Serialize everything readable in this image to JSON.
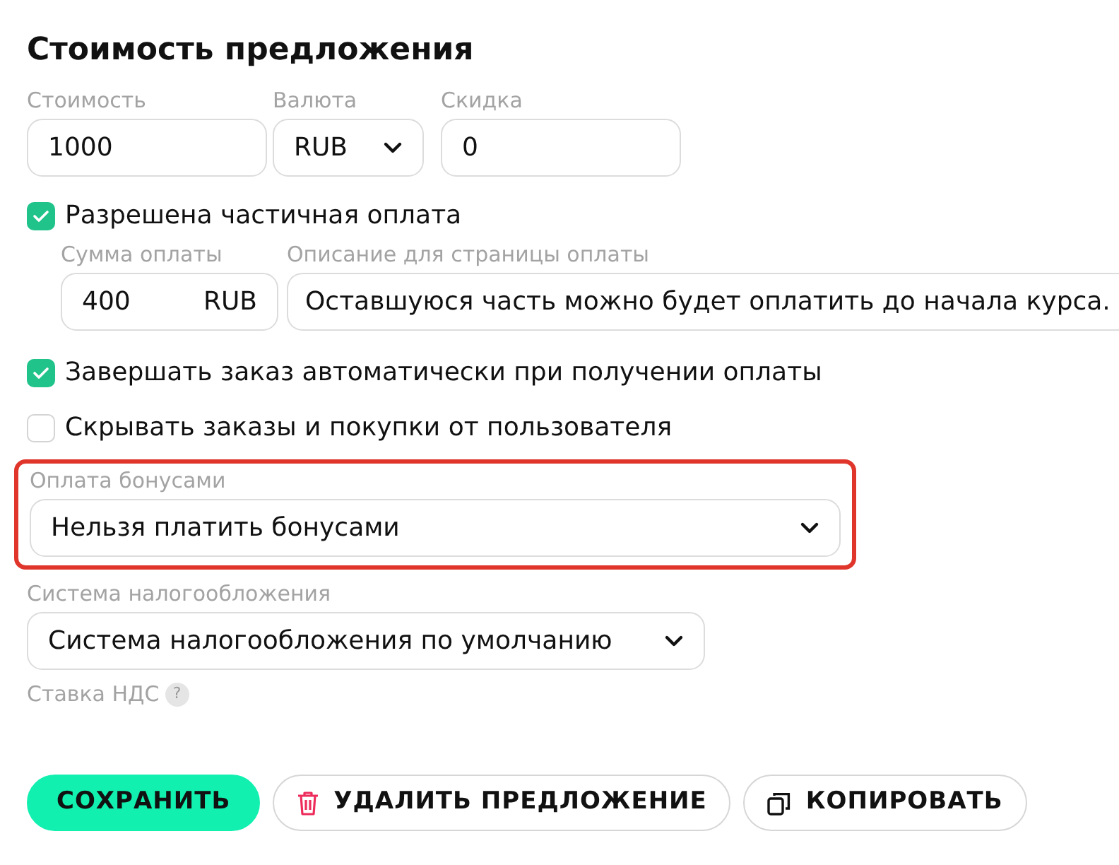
{
  "title": "Стоимость предложения",
  "price": {
    "label": "Стоимость",
    "value": "1000"
  },
  "currency": {
    "label": "Валюта",
    "value": "RUB"
  },
  "discount": {
    "label": "Скидка",
    "value": "0"
  },
  "partial_payment": {
    "label": "Разрешена частичная оплата",
    "checked": true
  },
  "payment_amount": {
    "label": "Сумма оплаты",
    "value": "400",
    "unit": "RUB"
  },
  "payment_description": {
    "label": "Описание для страницы оплаты",
    "value": "Оставшуюся часть можно будет оплатить до начала курса."
  },
  "checkboxes": [
    {
      "label": "Завершать заказ автоматически при получении оплаты",
      "checked": true
    },
    {
      "label": "Скрывать заказы и покупки от пользователя",
      "checked": false
    }
  ],
  "bonus_payment": {
    "label": "Оплата бонусами",
    "value": "Нельзя платить бонусами",
    "highlighted": true
  },
  "tax_system": {
    "label": "Система налогообложения",
    "value": "Система налогообложения по умолчанию"
  },
  "vat_rate": {
    "label": "Ставка НДС",
    "help": "?"
  },
  "buttons": [
    {
      "kind": "primary",
      "label": "СОХРАНИТЬ"
    },
    {
      "kind": "delete",
      "label": "УДАЛИТЬ ПРЕДЛОЖЕНИЕ"
    },
    {
      "kind": "copy",
      "label": "КОПИРОВАТЬ"
    }
  ]
}
